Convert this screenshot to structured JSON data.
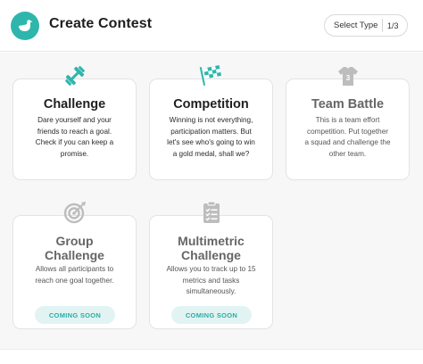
{
  "header": {
    "title": "Create Contest",
    "select_label": "Select Type",
    "step": "1/3"
  },
  "colors": {
    "accent": "#2eb6ad",
    "disabled_icon": "#bdbdbd",
    "soon_bg": "#e1f4f3"
  },
  "cards": [
    {
      "title": "Challenge",
      "icon": "dumbbell-icon",
      "description": [
        "Dare yourself and your",
        "friends to reach a goal.",
        "Check if you can keep a",
        "promise."
      ]
    },
    {
      "title": "Competition",
      "icon": "checkered-flag-icon",
      "description": [
        "Winning is not everything,",
        "participation matters. But",
        "let's see who's going to win",
        "a gold medal, shall we?"
      ]
    },
    {
      "title": "Team Battle",
      "icon": "jersey-icon",
      "jersey_number": "3",
      "description": [
        "This is a team effort",
        "competition. Put together",
        "a squad and challenge the",
        "other team."
      ]
    },
    {
      "title_lines": [
        "Group",
        "Challenge"
      ],
      "icon": "target-icon",
      "description": [
        "Allows all participants to",
        "reach one goal together."
      ],
      "badge": "COMING SOON"
    },
    {
      "title_lines": [
        "Multimetric",
        "Challenge"
      ],
      "icon": "checklist-icon",
      "description": [
        "Allows you to track up to 15",
        "metrics and tasks",
        "simultaneously."
      ],
      "badge": "COMING SOON"
    }
  ]
}
